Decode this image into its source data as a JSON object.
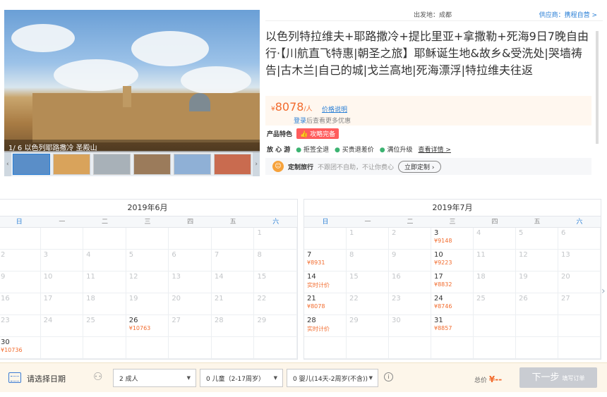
{
  "header": {
    "departure": "出发地：成都",
    "supplier": "供应商：携程自营 >"
  },
  "gallery": {
    "caption": "1/ 6 以色列耶路撒冷 圣殿山",
    "thumbs": [
      "#5a8ec8",
      "#d9a35b",
      "#a8b1b8",
      "#9b7b5b",
      "#8fb0d6",
      "#c96b4f"
    ],
    "prev_icon": "chevron-left-icon",
    "next_icon": "chevron-right-icon"
  },
  "product": {
    "title": "以色列特拉维夫+耶路撒冷+提比里亚+拿撒勒+死海9日7晚自由行·【川航直飞特惠|朝圣之旅】耶稣诞生地&故乡&受洗处|哭墙祷告|古木兰|自己的城|戈兰高地|死海漂浮|特拉维夫往返",
    "price_symbol": "¥",
    "price_value": "8078",
    "price_unit": "/人",
    "price_note": "价格说明",
    "login_link": "登录",
    "login_rest": "后查看更多优惠",
    "feature_label": "产品特色",
    "feature_tag": "攻略完备",
    "assure_label": "放 心 游",
    "assure_items": [
      "拒签全退",
      "买贵退差价",
      "满位升级"
    ],
    "assure_more": "查看详情 >",
    "custom_label": "定制旅行",
    "custom_desc": "不跟团不自助，不让你费心",
    "custom_button": "立即定制 ›"
  },
  "calendar": {
    "weekdays": [
      "日",
      "一",
      "二",
      "三",
      "四",
      "五",
      "六"
    ],
    "june": {
      "title": "2019年6月",
      "rows": [
        [
          [
            "",
            ""
          ],
          [
            "",
            ""
          ],
          [
            "",
            ""
          ],
          [
            "",
            ""
          ],
          [
            "",
            ""
          ],
          [
            "",
            ""
          ],
          [
            "1",
            ""
          ]
        ],
        [
          [
            "2",
            ""
          ],
          [
            "3",
            ""
          ],
          [
            "4",
            ""
          ],
          [
            "5",
            ""
          ],
          [
            "6",
            ""
          ],
          [
            "7",
            ""
          ],
          [
            "8",
            ""
          ]
        ],
        [
          [
            "9",
            ""
          ],
          [
            "10",
            ""
          ],
          [
            "11",
            ""
          ],
          [
            "12",
            ""
          ],
          [
            "13",
            ""
          ],
          [
            "14",
            ""
          ],
          [
            "15",
            ""
          ]
        ],
        [
          [
            "16",
            ""
          ],
          [
            "17",
            ""
          ],
          [
            "18",
            ""
          ],
          [
            "19",
            ""
          ],
          [
            "20",
            ""
          ],
          [
            "21",
            ""
          ],
          [
            "22",
            ""
          ]
        ],
        [
          [
            "23",
            ""
          ],
          [
            "24",
            ""
          ],
          [
            "25",
            ""
          ],
          [
            "26",
            "¥10763"
          ],
          [
            "27",
            ""
          ],
          [
            "28",
            ""
          ],
          [
            "29",
            ""
          ]
        ],
        [
          [
            "30",
            "¥10736"
          ],
          [
            "",
            ""
          ],
          [
            "",
            ""
          ],
          [
            "",
            ""
          ],
          [
            "",
            ""
          ],
          [
            "",
            ""
          ],
          [
            "",
            ""
          ]
        ]
      ]
    },
    "july": {
      "title": "2019年7月",
      "rows": [
        [
          [
            "",
            ""
          ],
          [
            "1",
            ""
          ],
          [
            "2",
            ""
          ],
          [
            "3",
            "¥9148"
          ],
          [
            "4",
            ""
          ],
          [
            "5",
            ""
          ],
          [
            "6",
            ""
          ]
        ],
        [
          [
            "7",
            "¥8931"
          ],
          [
            "8",
            ""
          ],
          [
            "9",
            ""
          ],
          [
            "10",
            "¥9223"
          ],
          [
            "11",
            ""
          ],
          [
            "12",
            ""
          ],
          [
            "13",
            ""
          ]
        ],
        [
          [
            "14",
            "实时计价"
          ],
          [
            "15",
            ""
          ],
          [
            "16",
            ""
          ],
          [
            "17",
            "¥8832"
          ],
          [
            "18",
            ""
          ],
          [
            "19",
            ""
          ],
          [
            "20",
            ""
          ]
        ],
        [
          [
            "21",
            "¥8078"
          ],
          [
            "22",
            ""
          ],
          [
            "23",
            ""
          ],
          [
            "24",
            "¥8746"
          ],
          [
            "25",
            ""
          ],
          [
            "26",
            ""
          ],
          [
            "27",
            ""
          ]
        ],
        [
          [
            "28",
            "实时计价"
          ],
          [
            "29",
            ""
          ],
          [
            "30",
            ""
          ],
          [
            "31",
            "¥8857"
          ],
          [
            "",
            ""
          ],
          [
            "",
            ""
          ],
          [
            "",
            ""
          ]
        ],
        [
          [
            "",
            ""
          ],
          [
            "",
            ""
          ],
          [
            "",
            ""
          ],
          [
            "",
            ""
          ],
          [
            "",
            ""
          ],
          [
            "",
            ""
          ],
          [
            "",
            ""
          ]
        ]
      ]
    }
  },
  "booking": {
    "select_date": "请选择日期",
    "adult": "2  成人",
    "child": "0  儿童（2-17周岁）",
    "infant": "0  婴儿(14天-2周岁(不含))",
    "help": "i",
    "total_label": "总价",
    "total_value": "¥--",
    "next_label": "下一步",
    "next_sub": "填写订单"
  }
}
